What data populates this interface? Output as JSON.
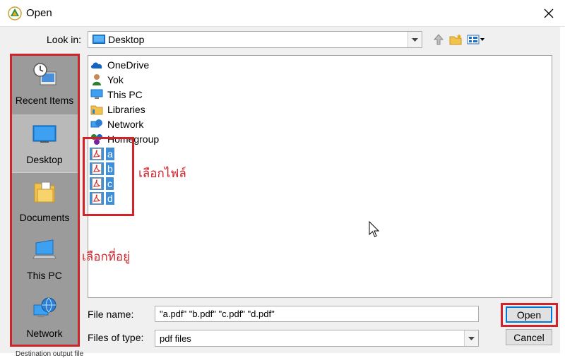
{
  "window": {
    "title": "Open"
  },
  "lookin": {
    "label": "Look in:",
    "value": "Desktop"
  },
  "places": [
    {
      "label": "Recent Items",
      "icon": "recent-items-icon"
    },
    {
      "label": "Desktop",
      "icon": "desktop-icon",
      "selected": true
    },
    {
      "label": "Documents",
      "icon": "documents-icon"
    },
    {
      "label": "This PC",
      "icon": "this-pc-icon"
    },
    {
      "label": "Network",
      "icon": "network-icon"
    }
  ],
  "files": [
    {
      "name": "OneDrive",
      "icon": "onedrive-icon"
    },
    {
      "name": "Yok",
      "icon": "user-icon"
    },
    {
      "name": "This PC",
      "icon": "this-pc-icon"
    },
    {
      "name": "Libraries",
      "icon": "libraries-icon"
    },
    {
      "name": "Network",
      "icon": "network-icon"
    },
    {
      "name": "Homegroup",
      "icon": "homegroup-icon"
    },
    {
      "name": "a",
      "icon": "pdf-icon",
      "selected": true
    },
    {
      "name": "b",
      "icon": "pdf-icon",
      "selected": true
    },
    {
      "name": "c",
      "icon": "pdf-icon",
      "selected": true
    },
    {
      "name": "d",
      "icon": "pdf-icon",
      "selected": true
    }
  ],
  "filename": {
    "label": "File name:",
    "value": "\"a.pdf\" \"b.pdf\" \"c.pdf\" \"d.pdf\""
  },
  "filetype": {
    "label": "Files of type:",
    "value": "pdf files"
  },
  "buttons": {
    "open": "Open",
    "cancel": "Cancel"
  },
  "annotations": {
    "select_file": "เลือกไฟล์",
    "select_location": "เลือกที่อยู่"
  },
  "background": {
    "partial_text": "Destination output file"
  },
  "colors": {
    "annotation": "#d2232a",
    "selection": "#3f8fd8",
    "places_bg": "#9b9b9b"
  }
}
